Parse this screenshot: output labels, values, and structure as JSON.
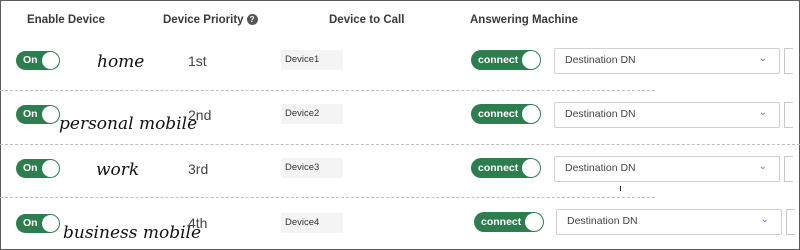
{
  "headers": {
    "enable_device": "Enable Device",
    "device_priority": "Device Priority",
    "device_to_call": "Device to Call",
    "answering_machine": "Answering Machine"
  },
  "rows": [
    {
      "toggle": "On",
      "name": "home",
      "priority": "1st",
      "device": "Device1",
      "answering": "connect",
      "destination": "Destination DN"
    },
    {
      "toggle": "On",
      "name": "personal mobile",
      "priority": "2nd",
      "device": "Device2",
      "answering": "connect",
      "destination": "Destination DN"
    },
    {
      "toggle": "On",
      "name": "work",
      "priority": "3rd",
      "device": "Device3",
      "answering": "connect",
      "destination": "Destination DN"
    },
    {
      "toggle": "On",
      "name": "business mobile",
      "priority": "4th",
      "device": "Device4",
      "answering": "connect",
      "destination": "Destination DN"
    }
  ],
  "colors": {
    "toggle_green": "#2e7d4f",
    "chevron_blue": "#5b7fbf"
  },
  "icons": {
    "help": "help-icon",
    "chevron": "chevron-down-icon"
  }
}
